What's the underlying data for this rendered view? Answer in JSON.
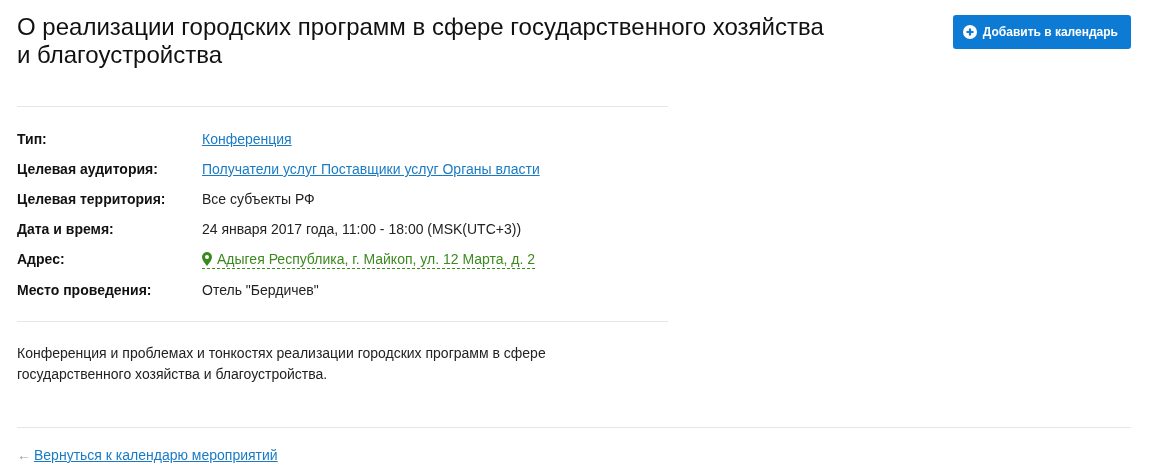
{
  "title": "О реализации городских программ в сфере государственного хозяйства и благоустройства",
  "add_button": {
    "label": "Добавить в календарь"
  },
  "details": [
    {
      "label": "Тип:",
      "kind": "link",
      "value": "Конференция"
    },
    {
      "label": "Целевая аудитория:",
      "kind": "link",
      "value": "Получатели услуг Поставщики услуг Органы власти"
    },
    {
      "label": "Целевая территория:",
      "kind": "text",
      "value": "Все субъекты РФ"
    },
    {
      "label": "Дата и время:",
      "kind": "text",
      "value": "24 января 2017 года, 11:00 - 18:00 (MSK(UTC+3))"
    },
    {
      "label": "Адрес:",
      "kind": "address",
      "value": "Адыгея Республика, г. Майкоп, ул. 12 Марта, д. 2"
    },
    {
      "label": "Место проведения:",
      "kind": "text",
      "value": "Отель \"Бердичев\""
    }
  ],
  "description": "Конференция и проблемах и тонкостях реализации городских программ в сфере государственного хозяйства и благоустройства.",
  "back_link": {
    "arrow": "←",
    "label": "Вернуться к календарю мероприятий"
  }
}
